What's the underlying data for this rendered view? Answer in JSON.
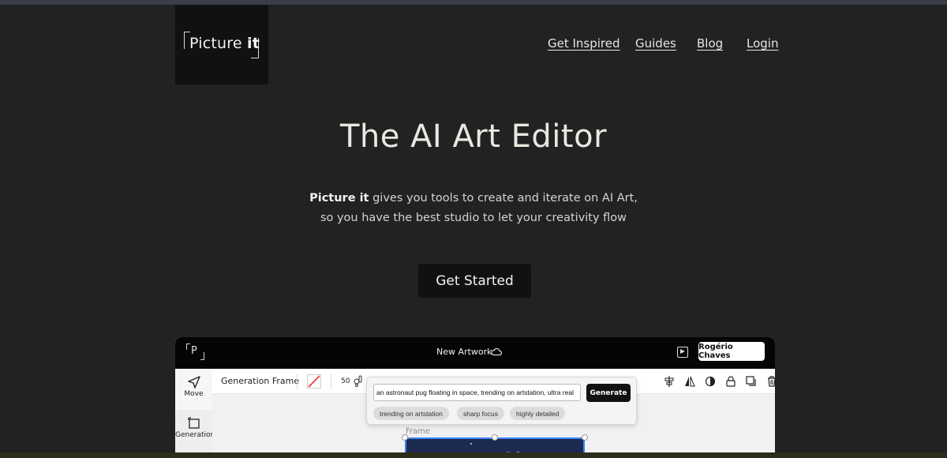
{
  "header": {
    "logo_text_regular": "Picture",
    "logo_text_bold": "it",
    "nav": [
      "Get Inspired",
      "Guides",
      "Blog",
      "Login"
    ]
  },
  "hero": {
    "title": "The AI Art Editor",
    "line1_bold": "Picture it",
    "line1_rest": " gives you tools to create and iterate on AI Art,",
    "line2": "so you have the best studio to let your creativity flow",
    "cta": "Get Started"
  },
  "app": {
    "logo_letter": "P",
    "artwork_title": "New Artwork",
    "user_name": "Rogério Chaves",
    "tools": [
      "Move",
      "Generation"
    ],
    "toolbar_label": "Generation Frame",
    "steps_value": "50",
    "prompt_value": "an astronaut pug floating in space, trending on artstation, ultra real",
    "generate_label": "Generate",
    "chips": [
      "trending on artstation",
      "sharp focus",
      "highly detailed"
    ],
    "frame_label": "Frame"
  },
  "colors": {
    "background": "#222222",
    "logo_box": "#101111",
    "cta_bg": "#101111",
    "frame_border": "#3b82f6"
  }
}
